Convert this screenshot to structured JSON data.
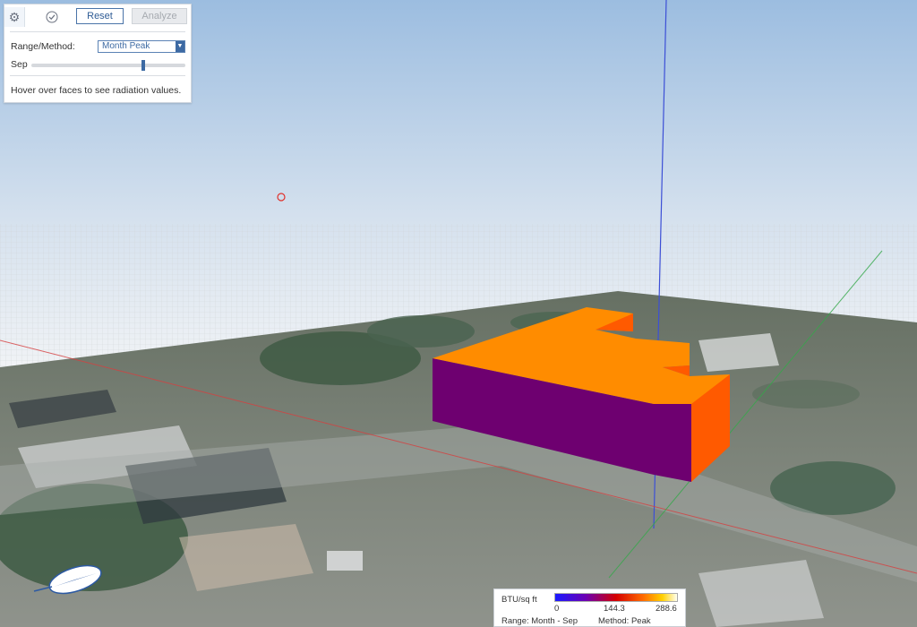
{
  "panel": {
    "settings_icon": "gear-icon",
    "check_icon": "check-circle-icon",
    "reset_label": "Reset",
    "analyze_label": "Analyze",
    "range_method_label": "Range/Method:",
    "range_method_value": "Month Peak",
    "month_label": "Sep",
    "month_slider_fraction": 0.73,
    "hint": "Hover over faces to see radiation values."
  },
  "legend": {
    "unit": "BTU/sq ft",
    "ticks": [
      "0",
      "144.3",
      "288.6"
    ],
    "range": "Range: Month - Sep",
    "method": "Method: Peak"
  },
  "colors": {
    "roof": "#ff8c00",
    "south_wall": "#6e0070",
    "east_wall": "#ff5a00",
    "accent": "#3d6aa3"
  },
  "compass_icon": "compass-needle-icon"
}
